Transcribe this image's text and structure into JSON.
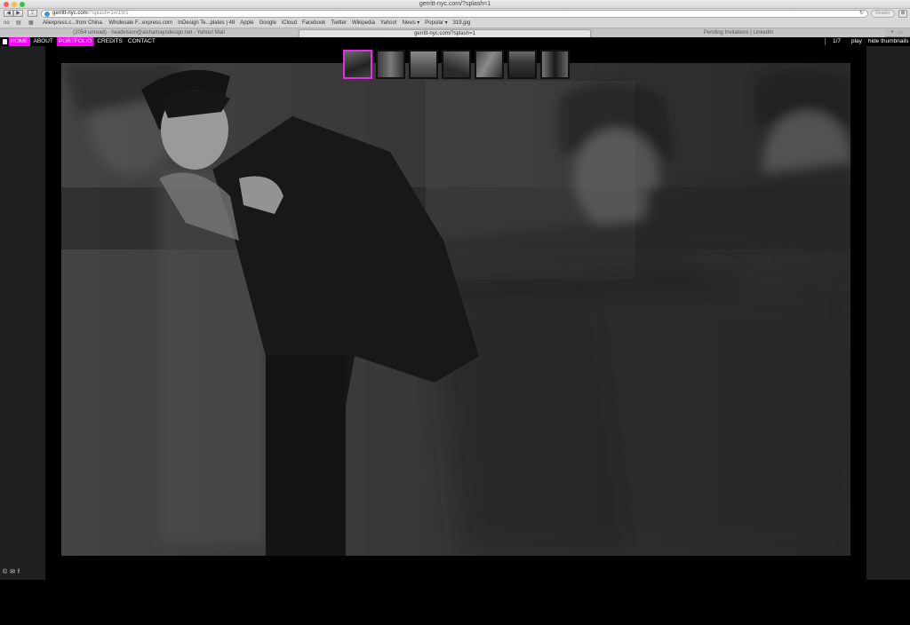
{
  "browser": {
    "window_title": "gerritt-nyc.com/?splash=1",
    "url_host": "gerritt-nyc.com",
    "url_rest": "/?splash=1#/19/1",
    "reader_label": "Reader",
    "bookmarks": [
      "Aliexpress.c...from China.",
      "Wholesale F...express.com",
      "InDesign Te...plates | 48",
      "Apple",
      "Google",
      "iCloud",
      "Facebook",
      "Twitter",
      "Wikipedia",
      "Yahoo!",
      "News ▾",
      "Popular ▾",
      "319.jpg"
    ],
    "tabs": [
      "(2054 unread) - headvision@aishamaysdesign.net - Yahoo! Mail",
      "gerritt-nyc.com/?splash=1",
      "Pending Invitations | LinkedIn"
    ]
  },
  "site": {
    "menu": [
      {
        "label": "HOME",
        "active": true
      },
      {
        "label": "ABOUT",
        "active": false
      },
      {
        "label": "PORTFOLIO",
        "active": true
      },
      {
        "label": "CREDITS",
        "active": false
      },
      {
        "label": "CONTACT",
        "active": false
      }
    ],
    "counter": "1/7",
    "play_label": "play",
    "hide_thumbnails_label": "hide thumbnails",
    "thumbnail_count": 7,
    "active_thumbnail": 1,
    "accent_color": "#ff00ff",
    "footer_icons": [
      "copyright-icon",
      "email-icon",
      "facebook-icon"
    ]
  }
}
